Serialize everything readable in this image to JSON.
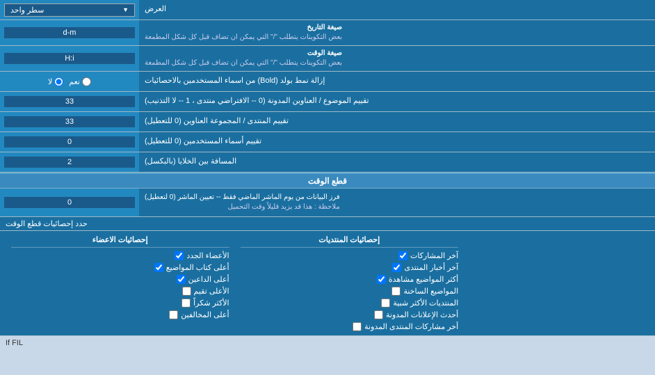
{
  "page": {
    "title": "العرض",
    "display_mode_label": "العرض",
    "display_mode_value": "سطر واحد",
    "date_format_label": "صيغة التاريخ",
    "date_format_note": "بعض التكوينات يتطلب \"/\" التي يمكن ان تضاف قبل كل شكل المطمعة",
    "date_format_value": "d-m",
    "time_format_label": "صيغة الوقت",
    "time_format_note": "بعض التكوينات يتطلب \"/\" التي يمكن ان تضاف قبل كل شكل المطمعة",
    "time_format_value": "H:i",
    "bold_label": "إزالة نمط بولد (Bold) من اسماء المستخدمين بالاحصائيات",
    "bold_yes": "نعم",
    "bold_no": "لا",
    "bold_selected": "no",
    "topic_order_label": "تقييم الموضوع / العناوين المدونة (0 -- الافتراضي منتدى ، 1 -- لا التذنيب)",
    "topic_order_value": "33",
    "forum_order_label": "تقييم المنتدى / المجموعة العناوين (0 للتعطيل)",
    "forum_order_value": "33",
    "users_label": "تقييم أسماء المستخدمين (0 للتعطيل)",
    "users_value": "0",
    "cell_spacing_label": "المسافة بين الخلايا (بالبكسل)",
    "cell_spacing_value": "2",
    "realtime_header": "قطع الوقت",
    "realtime_filter_label": "فرز البيانات من يوم الماشر الماضي فقط -- تعيين الماشر (0 لتعطيل)",
    "realtime_filter_note": "ملاحظة : هذا قد يزيد قليلاً وقت التحميل",
    "realtime_filter_value": "0",
    "limit_label": "حدد إحصائيات قطع الوقت",
    "stats_posts_header": "إحصائيات المنتديات",
    "stats_members_header": "إحصائيات الاعضاء",
    "checkboxes_posts": [
      "آخر المشاركات",
      "آخر أخبار المنتدى",
      "أكثر المواضيع مشاهدة",
      "المواضيع الساخنة",
      "المنتديات الأكثر شبية",
      "أحدث الإعلانات المدونة",
      "أخر مشاركات المنتدى المدونة"
    ],
    "checkboxes_members": [
      "الأعضاء الجدد",
      "أعلى كتاب المواضيع",
      "أعلى الداعين",
      "الأعلى تقيم",
      "الأكثر شكراً",
      "أعلى المخالفين"
    ],
    "if_fil_text": "If FIL"
  }
}
